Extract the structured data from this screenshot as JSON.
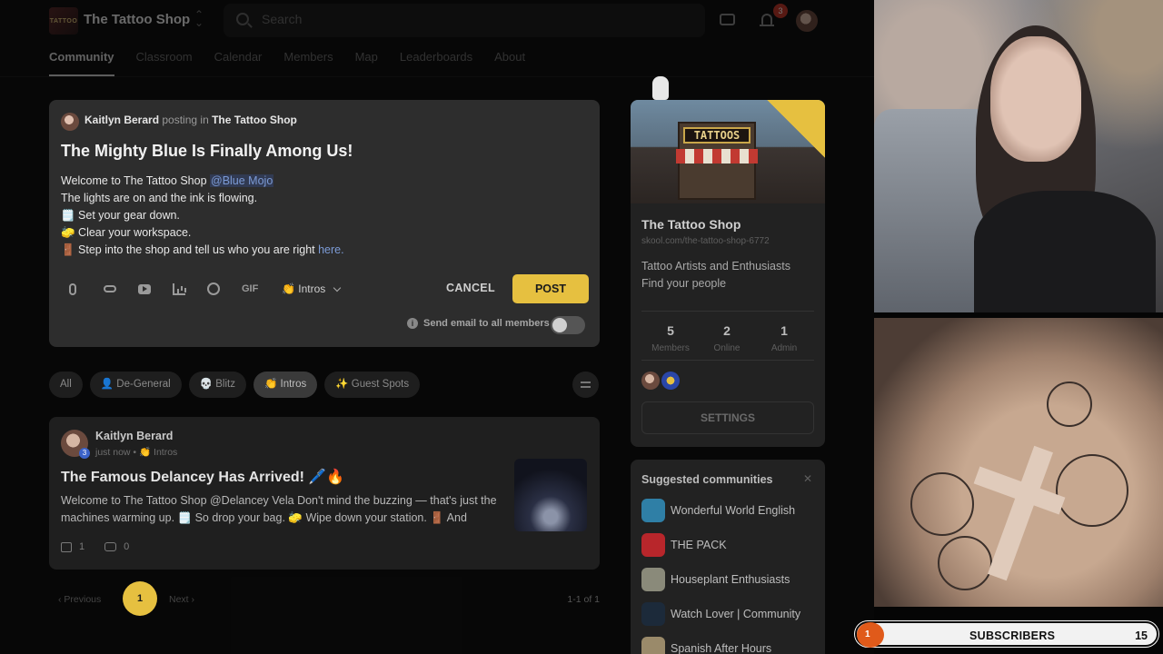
{
  "header": {
    "shop_name": "The Tattoo Shop",
    "logo_text": "TATTOO",
    "search_placeholder": "Search",
    "notification_count": "3"
  },
  "nav": {
    "tabs": [
      "Community",
      "Classroom",
      "Calendar",
      "Members",
      "Map",
      "Leaderboards",
      "About"
    ],
    "active": "Community"
  },
  "composer": {
    "author": "Kaitlyn Berard",
    "posting_in_text": "posting in",
    "community": "The Tattoo Shop",
    "title": "The Mighty Blue Is Finally Among Us!",
    "line1_prefix": "Welcome to The Tattoo Shop ",
    "mention": "@Blue Mojo",
    "line2": "The lights are on and the ink is flowing.",
    "line3": "🗒️ Set your gear down.",
    "line4": "🧽 Clear your workspace.",
    "line5_prefix": "🚪 Step into the shop and tell us who you are right ",
    "link": "here.",
    "gif_label": "GIF",
    "category": "👏 Intros",
    "cancel_label": "CANCEL",
    "post_label": "POST",
    "email_label": "Send email to all members"
  },
  "filters": [
    "All",
    "👤 De-General",
    "💀 Blitz",
    "👏 Intros",
    "✨ Guest Spots"
  ],
  "post": {
    "author": "Kaitlyn Berard",
    "level": "3",
    "meta": "just now • 👏 Intros",
    "title": "The Famous Delancey Has Arrived! 🖊️🔥",
    "excerpt": "Welcome to The Tattoo Shop @Delancey Vela Don't mind the buzzing — that's just the machines warming up. 🗒️ So drop your bag. 🧽 Wipe down your station. 🚪 And",
    "likes": "1",
    "comments": "0"
  },
  "pagination": {
    "prev": "‹ Previous",
    "current": "1",
    "next": "Next ›",
    "count": "1-1 of 1"
  },
  "about": {
    "banner_sign": "TATTOOS",
    "name": "The Tattoo Shop",
    "url": "skool.com/the-tattoo-shop-6772",
    "desc_line1": "Tattoo Artists and Enthusiasts",
    "desc_line2": "Find your people",
    "stats": [
      {
        "n": "5",
        "l": "Members"
      },
      {
        "n": "2",
        "l": "Online"
      },
      {
        "n": "1",
        "l": "Admin"
      }
    ],
    "settings_label": "SETTINGS"
  },
  "suggested": {
    "title": "Suggested communities",
    "items": [
      {
        "name": "Wonderful World English",
        "color": "#2f7fa6"
      },
      {
        "name": "THE PACK",
        "color": "#b8262b"
      },
      {
        "name": "Houseplant Enthusiasts",
        "color": "#8a8a7a"
      },
      {
        "name": "Watch Lover | Community",
        "color": "#1c2a3a"
      },
      {
        "name": "Spanish After Hours",
        "color": "#9a8a6a"
      }
    ]
  },
  "overlay": {
    "subscriber_count_badge": "1",
    "subscribers_label": "SUBSCRIBERS",
    "subscribers_value": "15"
  },
  "colors": {
    "accent": "#e6c040",
    "link": "#7c9bd6",
    "notification": "#c0392b"
  }
}
